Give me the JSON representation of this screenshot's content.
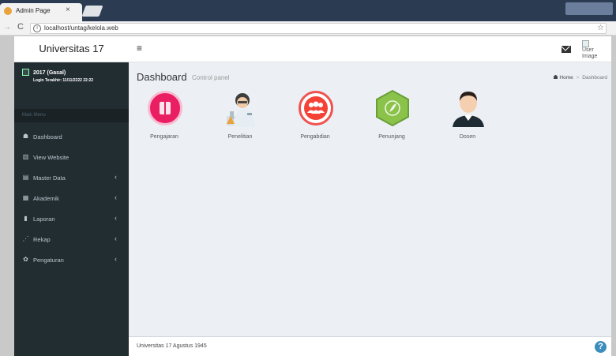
{
  "browser": {
    "tab_title": "Admin Page",
    "tab_close": "×",
    "url": "localhost/untag/kelola.web"
  },
  "header": {
    "logo": "Universitas 17",
    "toggle_icon": "≡",
    "user_image_alt": "User Image"
  },
  "sidebar": {
    "user_name": "2017 (Gasal)",
    "user_login": "Login Terakhir: 11/11/2222 22:22",
    "menu_header": "Main Menu",
    "items": [
      {
        "label": "Dashboard",
        "icon": "dashboard-icon",
        "glyph": "☗",
        "has_children": false
      },
      {
        "label": "View Website",
        "icon": "bank-icon",
        "glyph": "▥",
        "has_children": false
      },
      {
        "label": "Master Data",
        "icon": "database-icon",
        "glyph": "▤",
        "has_children": true
      },
      {
        "label": "Akademik",
        "icon": "calendar-icon",
        "glyph": "▦",
        "has_children": true
      },
      {
        "label": "Laporan",
        "icon": "file-icon",
        "glyph": "▮",
        "has_children": true
      },
      {
        "label": "Rekap",
        "icon": "line-chart-icon",
        "glyph": "⋰",
        "has_children": true
      },
      {
        "label": "Pengaturan",
        "icon": "gears-icon",
        "glyph": "✿",
        "has_children": true
      }
    ],
    "chevron": "‹"
  },
  "content": {
    "title": "Dashboard",
    "subtitle": "Control panel",
    "breadcrumb_home": "Home",
    "breadcrumb_sep": ">",
    "breadcrumb_active": "Dashboard"
  },
  "tiles": [
    {
      "label": "Pengajaran"
    },
    {
      "label": "Penelitian"
    },
    {
      "label": "Pengabdian"
    },
    {
      "label": "Penunjang"
    },
    {
      "label": "Dosen"
    }
  ],
  "footer": {
    "text": "Universitas 17 Agustus 1945",
    "help": "?"
  },
  "colors": {
    "sidebar_bg": "#222d32",
    "content_bg": "#ecf0f5",
    "pengajaran": "#e91e63",
    "pengabdian": "#f44336",
    "penunjang": "#8bc34a",
    "help": "#3c8dbc"
  }
}
